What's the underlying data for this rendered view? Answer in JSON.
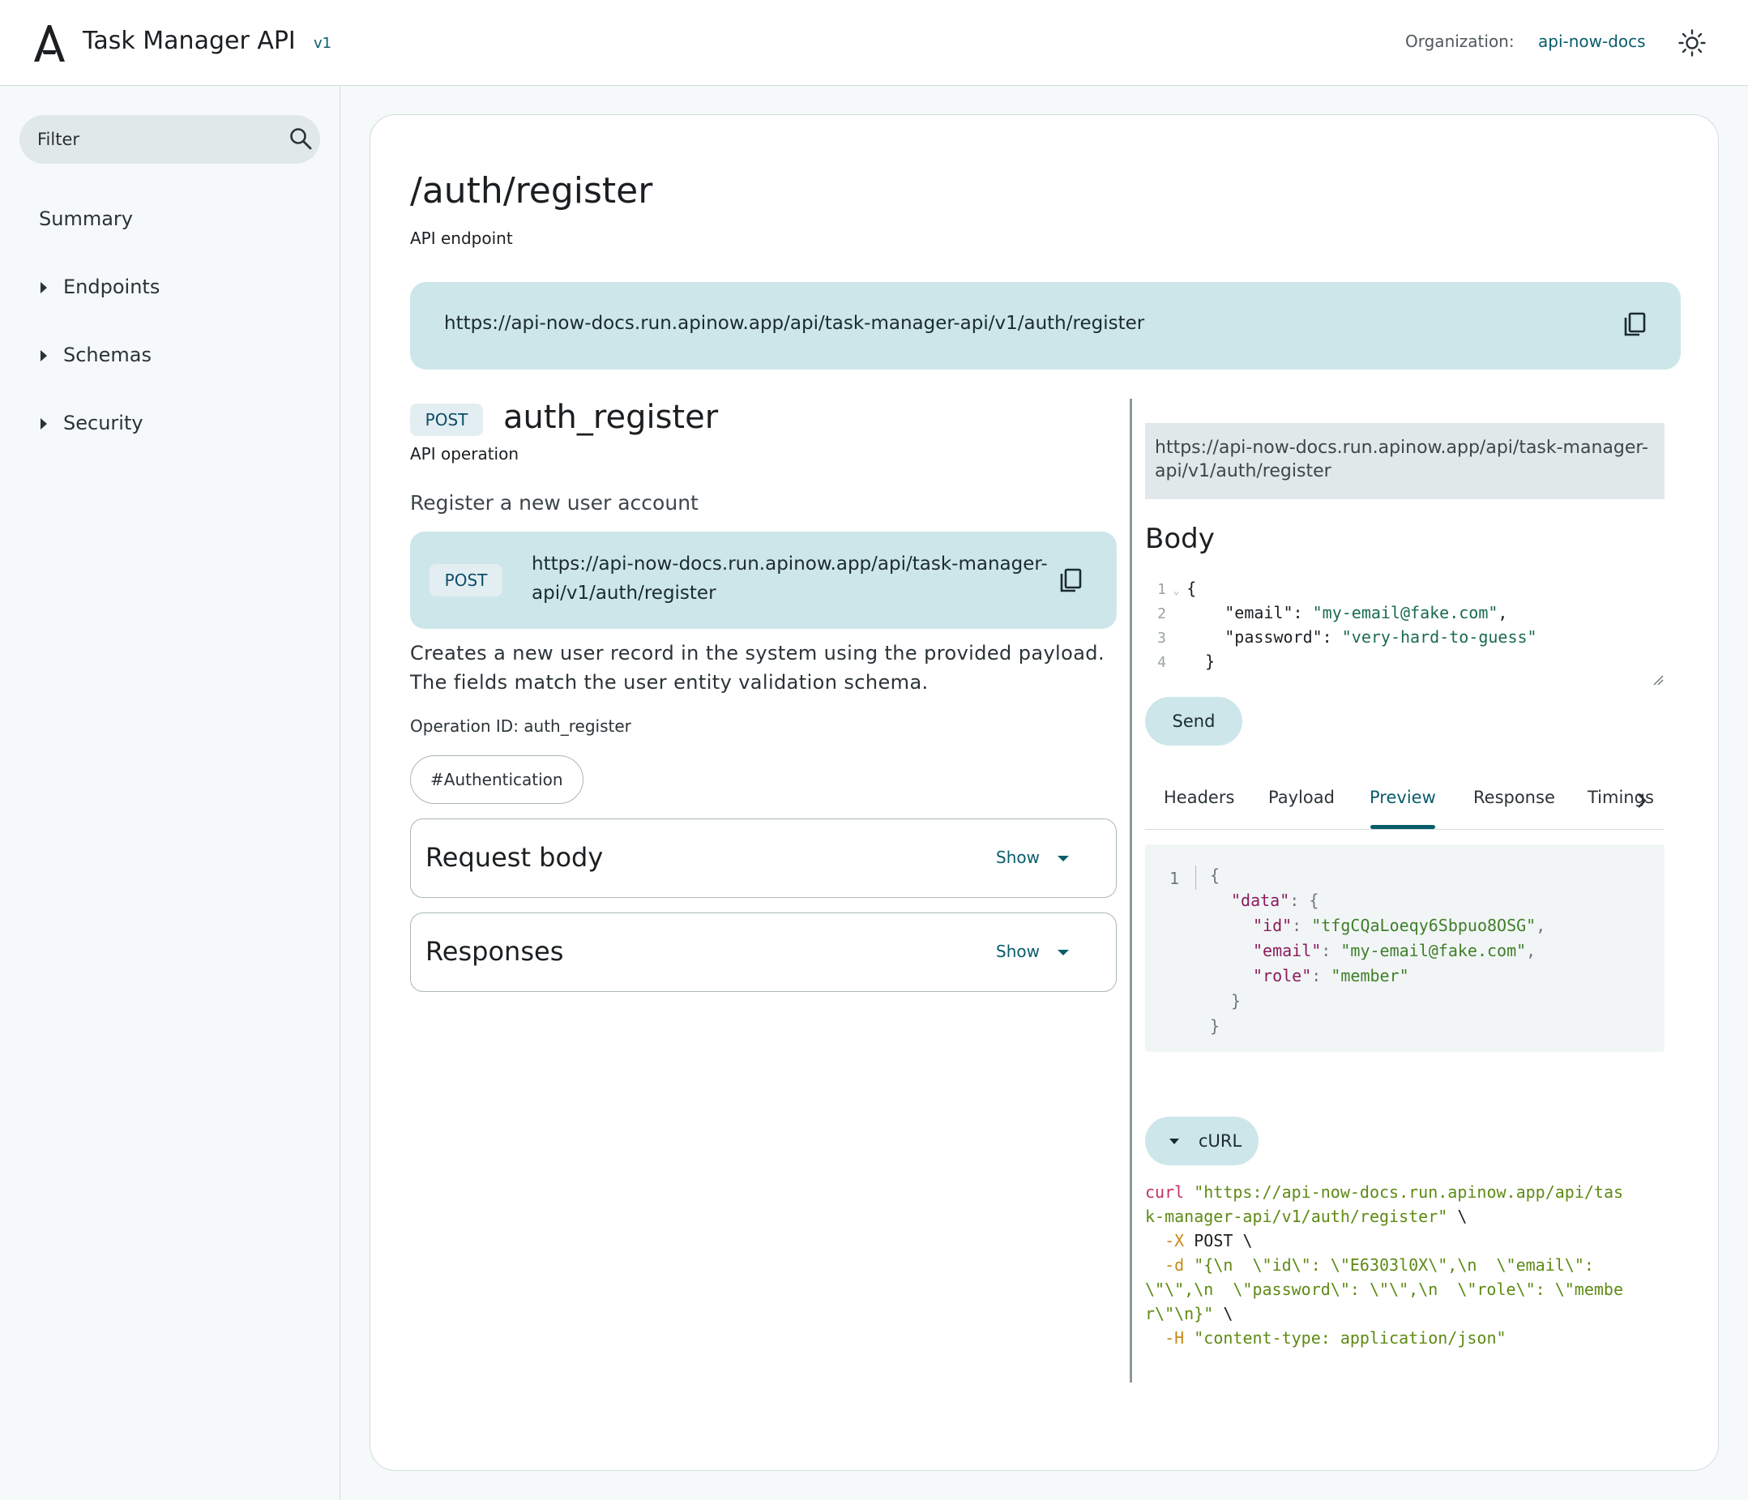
{
  "header": {
    "title": "Task Manager API",
    "version": "v1",
    "org_label": "Organization:",
    "org_name": "api-now-docs",
    "icons": {
      "logo": "a-logo-icon",
      "theme": "sun-icon"
    }
  },
  "sidebar": {
    "filter_placeholder": "Filter",
    "items": [
      {
        "label": "Summary"
      },
      {
        "label": "Endpoints"
      },
      {
        "label": "Schemas"
      },
      {
        "label": "Security"
      }
    ]
  },
  "page": {
    "title": "/auth/register",
    "subtitle": "API endpoint",
    "endpoint_url": "https://api-now-docs.run.apinow.app/api/task-manager-api/v1/auth/register"
  },
  "operation": {
    "method": "POST",
    "name": "auth_register",
    "label": "API operation",
    "summary": "Register a new user account",
    "url": "https://api-now-docs.run.apinow.app/api/task-manager-api/v1/auth/register",
    "description": "Creates a new user record in the system using the provided payload. The fields match the user entity validation schema.",
    "operation_id": "Operation ID: auth_register",
    "tag": "#Authentication",
    "request_body": {
      "title": "Request body",
      "toggle": "Show"
    },
    "responses": {
      "title": "Responses",
      "toggle": "Show"
    }
  },
  "try_panel": {
    "url": "https://api-now-docs.run.apinow.app/api/task-manager-api/v1/auth/register",
    "body_title": "Body",
    "body_lines": {
      "l1": {
        "n": "1",
        "text": "{"
      },
      "l2": {
        "n": "2",
        "key": "\"email\"",
        "sep": ": ",
        "val": "\"my-email@fake.com\"",
        "end": ","
      },
      "l3": {
        "n": "3",
        "key": "\"password\"",
        "sep": ": ",
        "val": "\"very-hard-to-guess\"",
        "end": ""
      },
      "l4": {
        "n": "4",
        "text": "}"
      }
    },
    "send_label": "Send",
    "tabs": [
      {
        "label": "Headers"
      },
      {
        "label": "Payload"
      },
      {
        "label": "Preview"
      },
      {
        "label": "Response"
      },
      {
        "label": "Timings"
      }
    ],
    "active_tab": "Preview",
    "preview": {
      "line_number": "1",
      "open": "{",
      "data_key": "\"data\"",
      "data_open": ": {",
      "id_key": "\"id\"",
      "id_val": "\"tfgCQaLoeqy6Sbpuo8OSG\"",
      "email_key": "\"email\"",
      "email_val": "\"my-email@fake.com\"",
      "role_key": "\"role\"",
      "role_val": "\"member\"",
      "inner_close": "}",
      "outer_close": "}"
    },
    "curl_label": "cURL",
    "curl": {
      "cmd": "curl",
      "url_part1": "\"https://api-now-docs.run.apinow.app/api/tas",
      "url_part2": "k-manager-api/v1/auth/register\"",
      "bs": " \\",
      "x_flag": "-X",
      "x_val": "POST",
      "d_flag": "-d",
      "d_part1": "\"{\\n  \\\"id\\\": \\\"E6303l0X\\\",\\n  \\\"email\\\":",
      "d_part2": "\\\"\\\",\\n  \\\"password\\\": \\\"\\\",\\n  \\\"role\\\": \\\"membe",
      "d_part3": "r\\\"\\n}\"",
      "h_flag": "-H",
      "h_val": "\"content-type: application/json\""
    }
  }
}
